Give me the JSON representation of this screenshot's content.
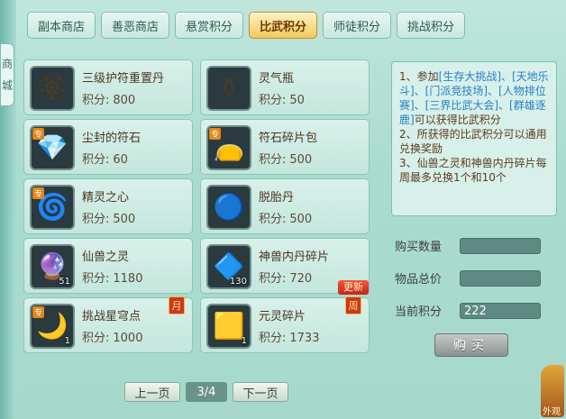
{
  "side_tab": "商\n城",
  "tabs": [
    {
      "label": "副本商店",
      "active": false
    },
    {
      "label": "善恶商店",
      "active": false
    },
    {
      "label": "悬赏积分",
      "active": false
    },
    {
      "label": "比武积分",
      "active": true
    },
    {
      "label": "师徒积分",
      "active": false
    },
    {
      "label": "挑战积分",
      "active": false
    }
  ],
  "price_prefix": "积分:",
  "items": [
    {
      "name": "三级护符重置丹",
      "price": "800",
      "icon": "gold-talisman-icon",
      "glyph": "🏵",
      "tag": "",
      "qty": "",
      "badge": "",
      "ribbon": ""
    },
    {
      "name": "灵气瓶",
      "price": "50",
      "icon": "spirit-vase-icon",
      "glyph": "⚱",
      "tag": "",
      "qty": "",
      "badge": "",
      "ribbon": ""
    },
    {
      "name": "尘封的符石",
      "price": "60",
      "icon": "rune-stone-icon",
      "glyph": "💎",
      "tag": "专",
      "qty": "",
      "badge": "",
      "ribbon": ""
    },
    {
      "name": "符石碎片包",
      "price": "500",
      "icon": "rune-pouch-icon",
      "glyph": "👝",
      "tag": "专",
      "qty": "",
      "badge": "",
      "ribbon": ""
    },
    {
      "name": "精灵之心",
      "price": "500",
      "icon": "spirit-heart-icon",
      "glyph": "🌀",
      "tag": "专",
      "qty": "",
      "badge": "",
      "ribbon": ""
    },
    {
      "name": "脱胎丹",
      "price": "500",
      "icon": "rebirth-pill-icon",
      "glyph": "🔵",
      "tag": "",
      "qty": "",
      "badge": "",
      "ribbon": ""
    },
    {
      "name": "仙兽之灵",
      "price": "1180",
      "icon": "beast-soul-icon",
      "glyph": "🔮",
      "tag": "",
      "qty": "51",
      "badge": "",
      "ribbon": ""
    },
    {
      "name": "神兽内丹碎片",
      "price": "720",
      "icon": "beast-core-shard-icon",
      "glyph": "🔷",
      "tag": "",
      "qty": "130",
      "badge": "",
      "ribbon": "更新"
    },
    {
      "name": "挑战星穹点",
      "price": "1000",
      "icon": "crescent-moon-icon",
      "glyph": "🌙",
      "tag": "专",
      "qty": "1",
      "badge": "月",
      "ribbon": ""
    },
    {
      "name": "元灵碎片",
      "price": "1733",
      "icon": "gold-shard-icon",
      "glyph": "🟨",
      "tag": "",
      "qty": "1",
      "badge": "周",
      "ribbon": ""
    }
  ],
  "pager": {
    "prev": "上一页",
    "page": "3/4",
    "next": "下一页"
  },
  "info": {
    "line1_pre": "1、参加",
    "links1": "[生存大挑战]、[天地乐斗]、[门派竞技场]、[人物排位赛]、[三界比武大会]、[群雄逐鹿]",
    "line1_post": "可以获得比武积分",
    "line2": "2、所获得的比武积分可以通用兑换奖励",
    "line3": "3、仙兽之灵和神兽内丹碎片每周最多兑换1个和10个"
  },
  "form": {
    "qty_label": "购买数量",
    "qty_value": "",
    "total_label": "物品总价",
    "total_value": "",
    "points_label": "当前积分",
    "points_value": "222"
  },
  "buy_button": "购买",
  "corner_text": "外观"
}
